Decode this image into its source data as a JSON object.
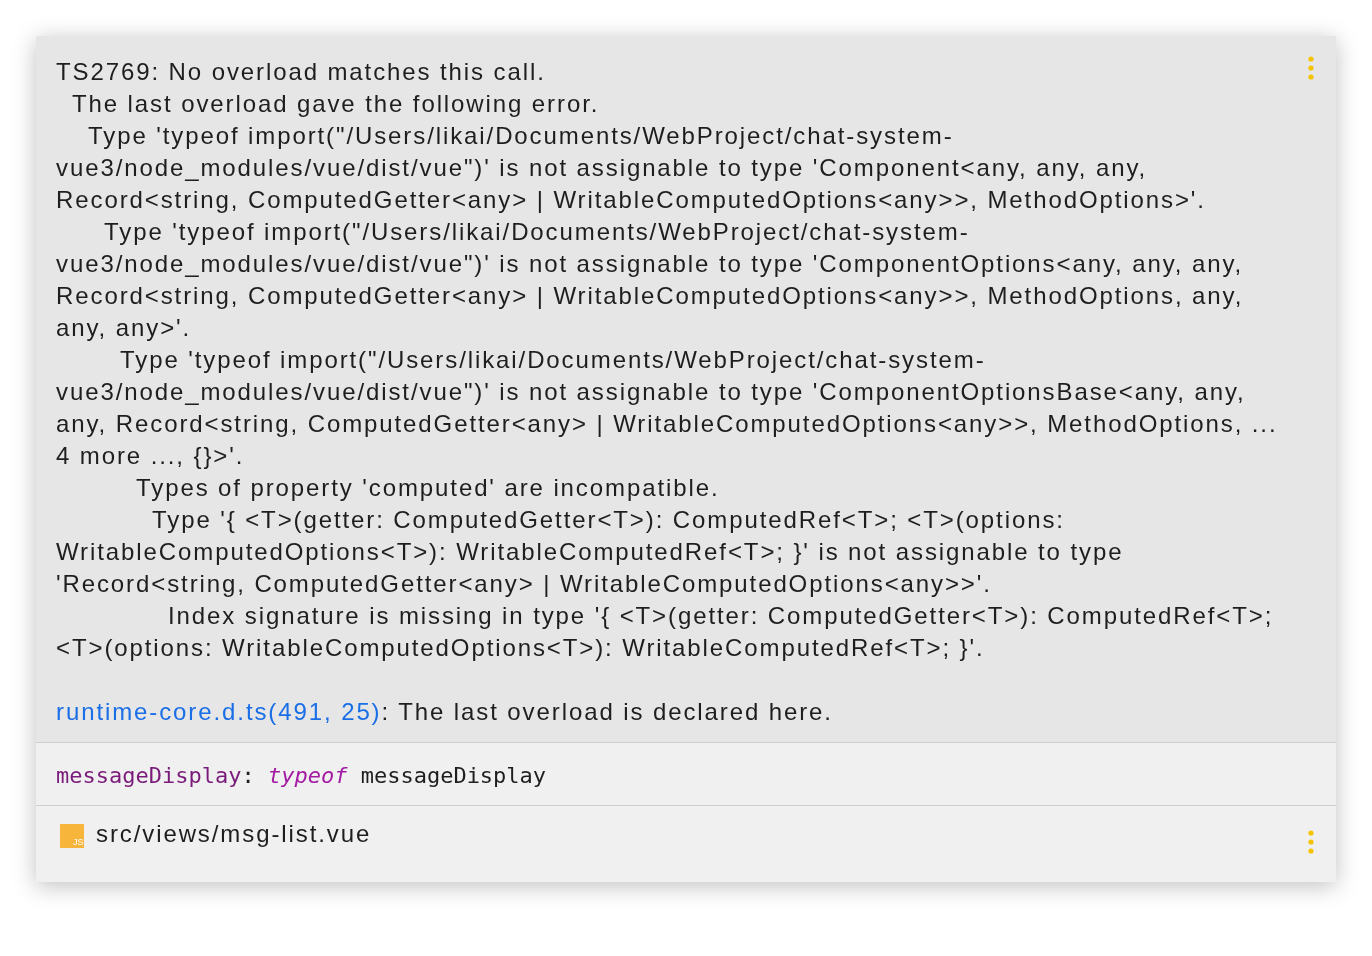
{
  "error": {
    "text": "TS2769: No overload matches this call.",
    "children": [
      {
        "text": "The last overload gave the following error.",
        "children": [
          {
            "text": "Type 'typeof import(\"/Users/likai/Documents/WebProject/chat-system-vue3/node_modules/vue/dist/vue\")' is not assignable to type 'Component<any, any, any, Record<string, ComputedGetter<any> | WritableComputedOptions<any>>, MethodOptions>'.",
            "children": [
              {
                "text": "Type 'typeof import(\"/Users/likai/Documents/WebProject/chat-system-vue3/node_modules/vue/dist/vue\")' is not assignable to type 'ComponentOptions<any, any, any, Record<string, ComputedGetter<any> | WritableComputedOptions<any>>, MethodOptions, any, any, any>'.",
                "children": [
                  {
                    "text": "Type 'typeof import(\"/Users/likai/Documents/WebProject/chat-system-vue3/node_modules/vue/dist/vue\")' is not assignable to type 'ComponentOptionsBase<any, any, any, Record<string, ComputedGetter<any> | WritableComputedOptions<any>>, MethodOptions, ... 4 more ..., {}>'.",
                    "children": [
                      {
                        "text": "Types of property 'computed' are incompatible.",
                        "children": [
                          {
                            "text": "Type '{ <T>(getter: ComputedGetter<T>): ComputedRef<T>; <T>(options: WritableComputedOptions<T>): WritableComputedRef<T>; }' is not assignable to type 'Record<string, ComputedGetter<any> | WritableComputedOptions<any>>'.",
                            "children": [
                              {
                                "text": "Index signature is missing in type '{ <T>(getter: ComputedGetter<T>): ComputedRef<T>; <T>(options: WritableComputedOptions<T>): WritableComputedRef<T>; }'."
                              }
                            ]
                          }
                        ]
                      }
                    ]
                  }
                ]
              }
            ]
          }
        ]
      }
    ]
  },
  "related": {
    "link": "runtime-core.d.ts(491, 25)",
    "text": ": The last overload is declared here."
  },
  "signature": [
    {
      "kind": "name",
      "text": "messageDisplay"
    },
    {
      "kind": "punct",
      "text": ": "
    },
    {
      "kind": "keyword",
      "text": "typeof"
    },
    {
      "kind": "plain",
      "text": " messageDisplay"
    }
  ],
  "file": {
    "icon_label": "JS",
    "path": "src/views/msg-list.vue"
  }
}
